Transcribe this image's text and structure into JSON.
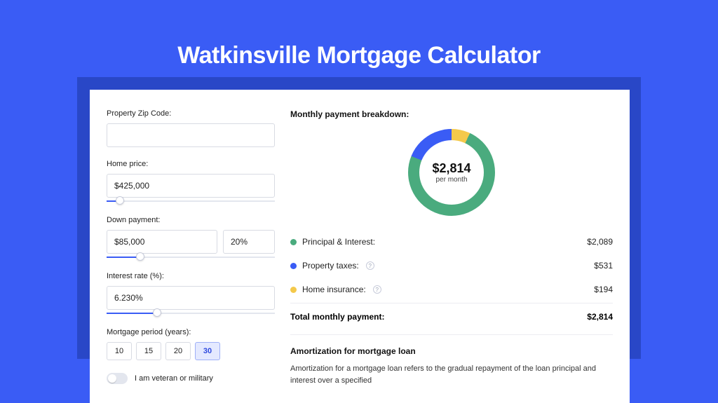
{
  "title": "Watkinsville Mortgage Calculator",
  "form": {
    "zip_label": "Property Zip Code:",
    "zip_value": "",
    "home_price_label": "Home price:",
    "home_price_value": "$425,000",
    "home_price_slider_pct": 8,
    "down_payment_label": "Down payment:",
    "down_payment_value": "$85,000",
    "down_payment_pct_value": "20%",
    "down_payment_slider_pct": 20,
    "interest_label": "Interest rate (%):",
    "interest_value": "6.230%",
    "interest_slider_pct": 30,
    "period_label": "Mortgage period (years):",
    "periods": [
      "10",
      "15",
      "20",
      "30"
    ],
    "period_selected": "30",
    "veteran_label": "I am veteran or military",
    "veteran_on": false
  },
  "breakdown": {
    "title": "Monthly payment breakdown:",
    "center_amount": "$2,814",
    "center_sub": "per month",
    "items": [
      {
        "label": "Principal & Interest:",
        "value": "$2,089",
        "color": "green",
        "info": false
      },
      {
        "label": "Property taxes:",
        "value": "$531",
        "color": "blue",
        "info": true
      },
      {
        "label": "Home insurance:",
        "value": "$194",
        "color": "yellow",
        "info": true
      }
    ],
    "total_label": "Total monthly payment:",
    "total_value": "$2,814"
  },
  "amort": {
    "title": "Amortization for mortgage loan",
    "body": "Amortization for a mortgage loan refers to the gradual repayment of the loan principal and interest over a specified"
  },
  "chart_data": {
    "type": "pie",
    "title": "Monthly payment breakdown",
    "series": [
      {
        "name": "Principal & Interest",
        "value": 2089,
        "color": "#4aab7e"
      },
      {
        "name": "Property taxes",
        "value": 531,
        "color": "#3a5cf5"
      },
      {
        "name": "Home insurance",
        "value": 194,
        "color": "#f4c94b"
      }
    ],
    "total": 2814,
    "center_label": "$2,814 per month"
  }
}
